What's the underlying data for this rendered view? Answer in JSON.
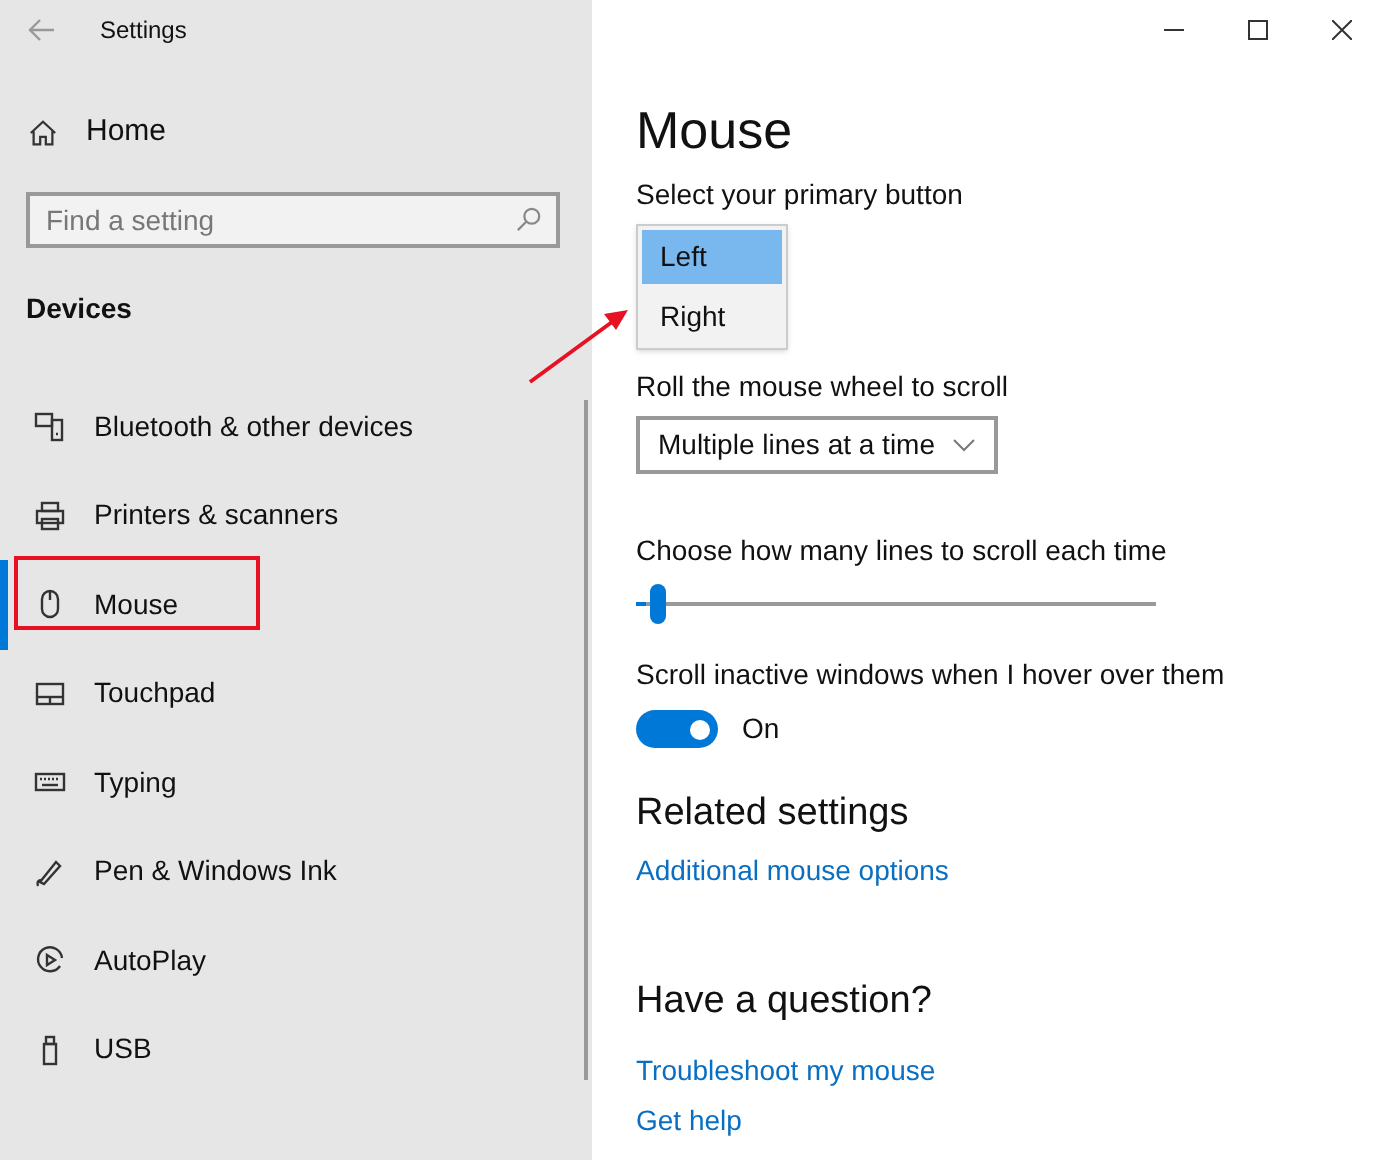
{
  "window": {
    "title": "Settings"
  },
  "sidebar": {
    "home": "Home",
    "search": {
      "placeholder": "Find a setting"
    },
    "section": "Devices",
    "items": [
      {
        "label": "Bluetooth & other devices",
        "kind": "bluetooth",
        "selected": false
      },
      {
        "label": "Printers & scanners",
        "kind": "printer",
        "selected": false
      },
      {
        "label": "Mouse",
        "kind": "mouse",
        "selected": true
      },
      {
        "label": "Touchpad",
        "kind": "touchpad",
        "selected": false
      },
      {
        "label": "Typing",
        "kind": "keyboard",
        "selected": false
      },
      {
        "label": "Pen & Windows Ink",
        "kind": "pen",
        "selected": false
      },
      {
        "label": "AutoPlay",
        "kind": "autoplay",
        "selected": false
      },
      {
        "label": "USB",
        "kind": "usb",
        "selected": false
      }
    ]
  },
  "content": {
    "title": "Mouse",
    "primary_button": {
      "label": "Select your primary button",
      "options": [
        {
          "label": "Left",
          "selected": true
        },
        {
          "label": "Right",
          "selected": false
        }
      ]
    },
    "wheel": {
      "label": "Roll the mouse wheel to scroll",
      "value": "Multiple lines at a time"
    },
    "lines": {
      "label": "Choose how many lines to scroll each time",
      "level": 0.02
    },
    "inactive": {
      "label": "Scroll inactive windows when I hover over them",
      "on": true,
      "state_text": "On"
    },
    "related": {
      "heading": "Related settings",
      "links": [
        "Additional mouse options"
      ]
    },
    "question": {
      "heading": "Have a question?",
      "links": [
        "Troubleshoot my mouse",
        "Get help"
      ]
    }
  }
}
